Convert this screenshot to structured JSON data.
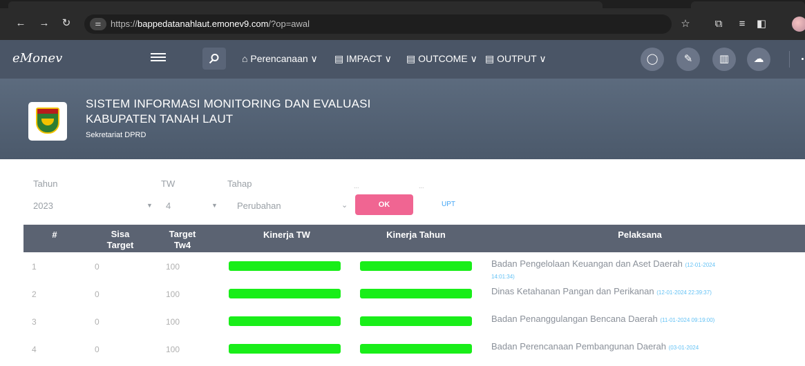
{
  "browser": {
    "url_prefix": "https://",
    "url_domain": "bappedatanahlaut.emonev9.com",
    "url_path": "/?op=awal"
  },
  "app": {
    "logo": "eMonev",
    "menu": [
      "Perencanaan ∨",
      "IMPACT ∨",
      "OUTCOME ∨",
      "OUTPUT ∨"
    ]
  },
  "header": {
    "title_line1": "SISTEM INFORMASI MONITORING DAN EVALUASI",
    "title_line2": "KABUPATEN TANAH LAUT",
    "subtitle": "Sekretariat DPRD",
    "crest_text": "TANAH LAUT"
  },
  "filters": {
    "tahun_label": "Tahun",
    "tahun_value": "2023",
    "tw_label": "TW",
    "tw_value": "4",
    "tahap_label": "Tahap",
    "tahap_value": "Perubahan",
    "dots1": "...",
    "dots2": "...",
    "ok_label": "OK",
    "upt_label": "UPT"
  },
  "table": {
    "headers": {
      "num": "#",
      "sisa": "Sisa Target",
      "target": "Target Tw4",
      "kinerja_tw": "Kinerja TW",
      "kinerja_tahun": "Kinerja Tahun",
      "pelaksana": "Pelaksana"
    },
    "rows": [
      {
        "num": "1",
        "sisa": "0",
        "target": "100",
        "kinerja_tw": 1.0,
        "kinerja_tahun": 1.0,
        "pelaksana": "Badan Pengelolaan Keuangan dan Aset Daerah",
        "timestamp": "(12-01-2024 14:01:34)"
      },
      {
        "num": "2",
        "sisa": "0",
        "target": "100",
        "kinerja_tw": 1.0,
        "kinerja_tahun": 1.0,
        "pelaksana": "Dinas Ketahanan Pangan dan Perikanan",
        "timestamp": "(12-01-2024 22:39:37)"
      },
      {
        "num": "3",
        "sisa": "0",
        "target": "100",
        "kinerja_tw": 1.0,
        "kinerja_tahun": 1.0,
        "pelaksana": "Badan Penanggulangan Bencana Daerah",
        "timestamp": "(11-01-2024 09:19:00)"
      },
      {
        "num": "4",
        "sisa": "0",
        "target": "100",
        "kinerja_tw": 1.0,
        "kinerja_tahun": 1.0,
        "pelaksana": "Badan Perencanaan Pembangunan Daerah",
        "timestamp": "(03-01-2024"
      }
    ]
  },
  "colors": {
    "nav": "#4a5566",
    "header": "#55637a",
    "ok": "#f06592",
    "bar": "#19ee19",
    "thead": "#5b6372"
  }
}
